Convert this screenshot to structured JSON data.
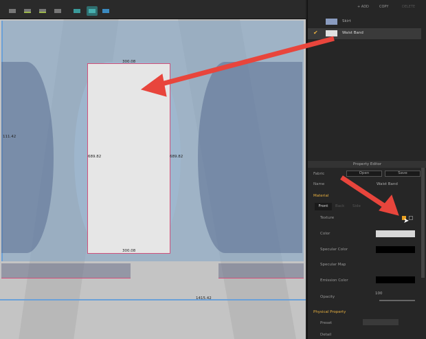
{
  "toolbar": {
    "tools": [
      "select-arrow",
      "segment-tool",
      "curve-tool",
      "edit-curve",
      "select-mesh",
      "texture-tool",
      "uv-tool"
    ]
  },
  "canvas": {
    "labels": {
      "top_width": "300.08",
      "bottom_width": "300.08",
      "left_height": "111.42",
      "height_left": "689.82",
      "height_right": "689.82",
      "total_width": "1415.42"
    }
  },
  "object_browser": {
    "add": "+ ADD",
    "copy": "COPY",
    "delete": "DELETE",
    "items": [
      {
        "label": "Skirt",
        "swatch": "#8a9cc0",
        "selected": false
      },
      {
        "label": "Waist Band",
        "swatch": "#e0e0e0",
        "selected": true
      }
    ]
  },
  "property_editor": {
    "title": "Property Editor",
    "fabric_label": "Fabric",
    "open": "Open",
    "save": "Save",
    "name_label": "Name",
    "name_value": "Waist Band",
    "material": "Material",
    "tabs": [
      "Front",
      "Back",
      "Side"
    ],
    "active_tab": "Front",
    "texture": "Texture",
    "color": "Color",
    "color_value": "#d8d8d8",
    "specular_color": "Specular Color",
    "specular_value": "#000000",
    "specular_map": "Specular Map",
    "emission_color": "Emission Color",
    "emission_value": "#000000",
    "opacity": "Opacity",
    "opacity_value": "100",
    "physical_property": "Physical Property",
    "preset": "Preset",
    "detail": "Detail"
  },
  "colors": {
    "accent": "#e8b040",
    "arrow": "#e8453c",
    "selection": "#d0507a"
  }
}
